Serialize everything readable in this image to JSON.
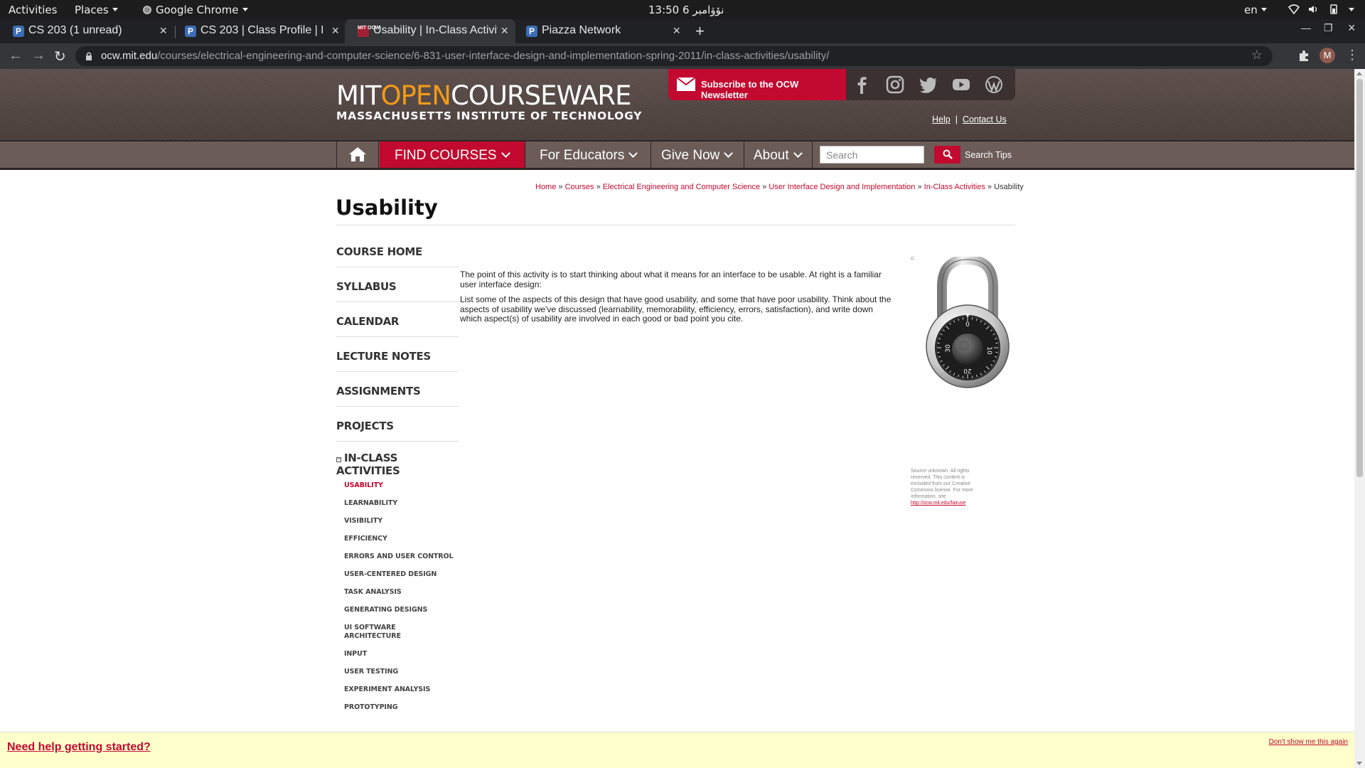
{
  "system_bar": {
    "activities": "Activities",
    "places": "Places",
    "app": "Google Chrome",
    "clock": "13:50  6 نۆۋامبر",
    "lang": "en"
  },
  "tabs": [
    {
      "title": "CS 203 (1 unread)",
      "favicon": "P",
      "active": false
    },
    {
      "title": "CS 203 | Class Profile | P",
      "favicon": "P",
      "active": false
    },
    {
      "title": "Usability | In-Class Activit",
      "favicon": "MIT OCW",
      "active": true
    },
    {
      "title": "Piazza Network",
      "favicon": "P",
      "active": false
    }
  ],
  "address_bar": {
    "host": "ocw.mit.edu",
    "path": "/courses/electrical-engineering-and-computer-science/6-831-user-interface-design-and-implementation-spring-2011/in-class-activities/usability/",
    "profile_initial": "M"
  },
  "header": {
    "logo_mit": "MIT",
    "logo_open": "OPEN",
    "logo_cw": "COURSEWARE",
    "logo_sub": "MASSACHUSETTS INSTITUTE OF TECHNOLOGY",
    "newsletter": "Subscribe to the OCW Newsletter",
    "help": "Help",
    "sep": "|",
    "contact": "Contact Us"
  },
  "nav": {
    "find_courses": "FIND COURSES",
    "for_educators": "For Educators",
    "give_now": "Give Now",
    "about": "About",
    "search_placeholder": "Search",
    "search_tips": "Search Tips"
  },
  "breadcrumb": {
    "home": "Home",
    "courses": "Courses",
    "dept": "Electrical Engineering and Computer Science",
    "course": "User Interface Design and Implementation",
    "section": "In-Class Activities",
    "current": "Usability",
    "sep": " » "
  },
  "page": {
    "title": "Usability",
    "paragraph1": "The point of this activity is to start thinking about what it means for an interface to be usable. At right is a familiar user interface design:",
    "paragraph2": "List some of the aspects of this design that have good usability, and some that have poor usability. Think about the aspects of usability we've discussed (learnability, memorability, efficiency, errors, satisfaction), and write down which aspect(s) of usability are involved in each good or bad point you cite."
  },
  "sidebar": {
    "items": [
      "COURSE HOME",
      "SYLLABUS",
      "CALENDAR",
      "LECTURE NOTES",
      "ASSIGNMENTS",
      "PROJECTS"
    ],
    "active_section": "IN-CLASS ACTIVITIES",
    "sub_items": [
      "USABILITY",
      "LEARNABILITY",
      "VISIBILITY",
      "EFFICIENCY",
      "ERRORS AND USER CONTROL",
      "USER-CENTERED DESIGN",
      "TASK ANALYSIS",
      "GENERATING DESIGNS",
      "UI SOFTWARE ARCHITECTURE",
      "INPUT",
      "USER TESTING",
      "EXPERIMENT ANALYSIS",
      "PROTOTYPING"
    ]
  },
  "figure": {
    "copyright_mark": "©",
    "caption": "Source unknown. All rights reserved. This content is excluded from our Creative Commons license. For more information, see",
    "caption_link": "http://ocw.mit.edu/fairuse",
    "dial_numbers": [
      "0",
      "10",
      "20",
      "30"
    ]
  },
  "help_bar": {
    "link": "Need help getting started?",
    "dismiss": "Don't show me this again"
  },
  "colors": {
    "accent": "#c2092f",
    "header_bg": "#5e504d",
    "open_orange": "#f39b16",
    "help_bg": "#ffffcc"
  }
}
